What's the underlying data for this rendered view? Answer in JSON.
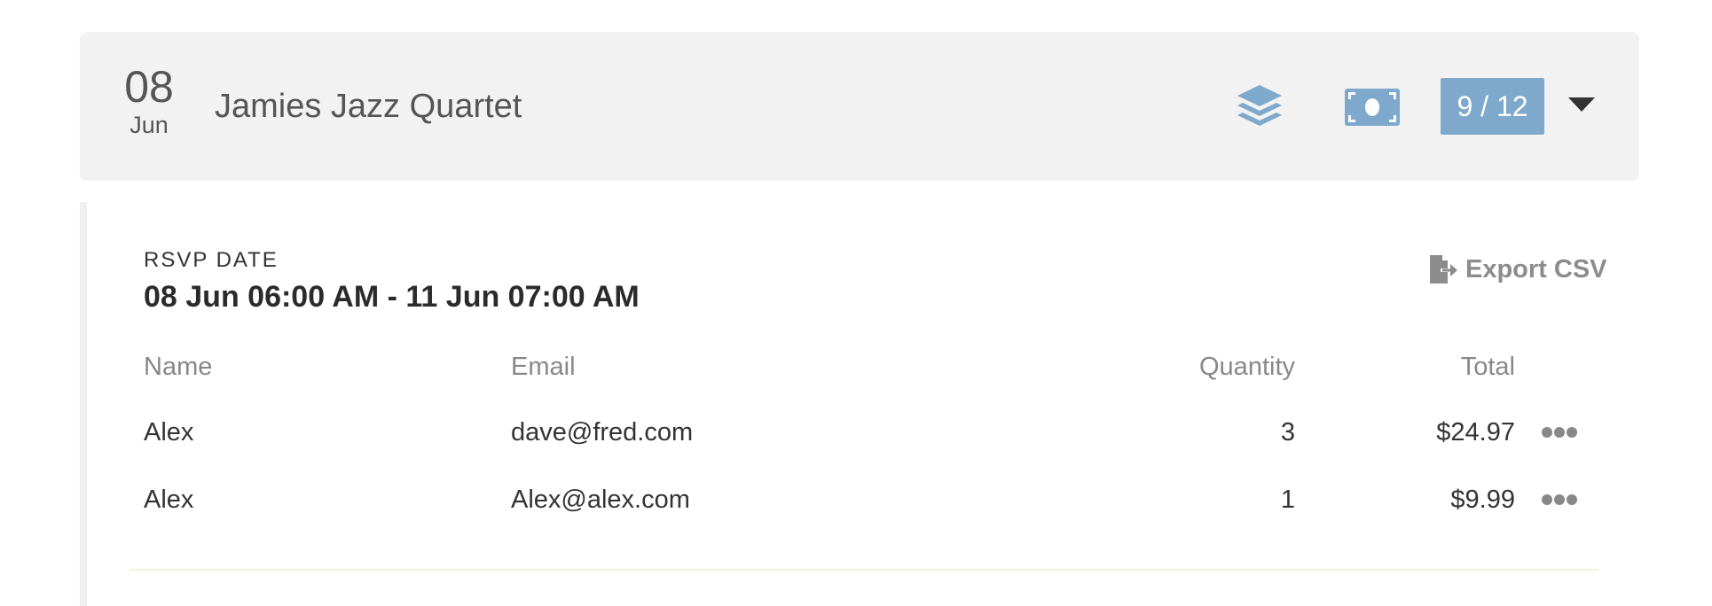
{
  "event": {
    "day": "08",
    "month": "Jun",
    "title": "Jamies Jazz Quartet",
    "count_badge": "9 / 12",
    "icons": {
      "layers": "layers-icon",
      "money": "money-icon",
      "caret": "caret-down-icon"
    }
  },
  "rsvp": {
    "label": "RSVP DATE",
    "range": "08 Jun 06:00 AM - 11 Jun 07:00 AM",
    "export_label": "Export CSV",
    "export_icon": "file-export-icon"
  },
  "table": {
    "headers": {
      "name": "Name",
      "email": "Email",
      "quantity": "Quantity",
      "total": "Total"
    },
    "rows": [
      {
        "name": "Alex",
        "email": "dave@fred.com",
        "quantity": "3",
        "total": "$24.97"
      },
      {
        "name": "Alex",
        "email": "Alex@alex.com",
        "quantity": "1",
        "total": "$9.99"
      }
    ]
  },
  "colors": {
    "accent": "#7ea9cc",
    "header_bg": "#f2f2f2",
    "muted_text": "#888888",
    "divider": "#eef5d6"
  }
}
